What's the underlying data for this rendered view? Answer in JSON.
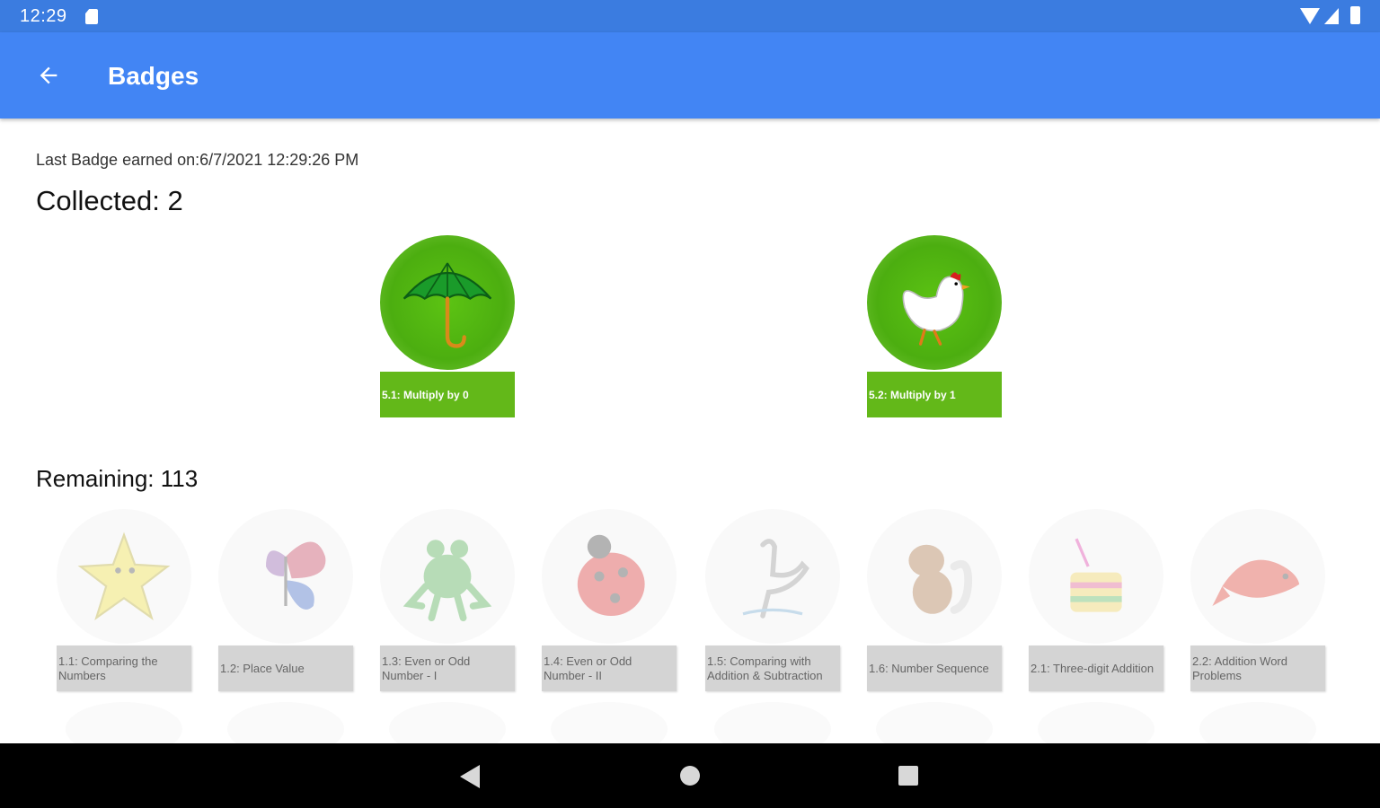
{
  "status_bar": {
    "time": "12:29"
  },
  "app_bar": {
    "title": "Badges"
  },
  "summary": {
    "last_earned": "Last Badge earned on:6/7/2021 12:29:26 PM",
    "collected": "Collected: 2",
    "remaining": "Remaining: 113"
  },
  "collected_badges": [
    {
      "label": "5.1: Multiply by 0",
      "icon": "umbrella-icon"
    },
    {
      "label": "5.2: Multiply by 1",
      "icon": "hen-icon"
    }
  ],
  "remaining_badges": [
    {
      "label": "1.1: Comparing the Numbers",
      "icon": "star-icon"
    },
    {
      "label": "1.2: Place Value",
      "icon": "butterfly-icon"
    },
    {
      "label": "1.3: Even or Odd Number - I",
      "icon": "frog-icon"
    },
    {
      "label": "1.4: Even or Odd Number - II",
      "icon": "ladybug-icon"
    },
    {
      "label": "1.5: Comparing with Addition & Subtraction",
      "icon": "heron-icon"
    },
    {
      "label": "1.6: Number Sequence",
      "icon": "dog-icon"
    },
    {
      "label": "2.1: Three-digit Addition",
      "icon": "cake-icon"
    },
    {
      "label": "2.2: Addition Word Problems",
      "icon": "fish-icon"
    }
  ],
  "colors": {
    "app_bar": "#4285f4",
    "status_bar": "#3b7ce0",
    "badge_green": "#63b819",
    "locked_label": "#d4d4d4"
  }
}
